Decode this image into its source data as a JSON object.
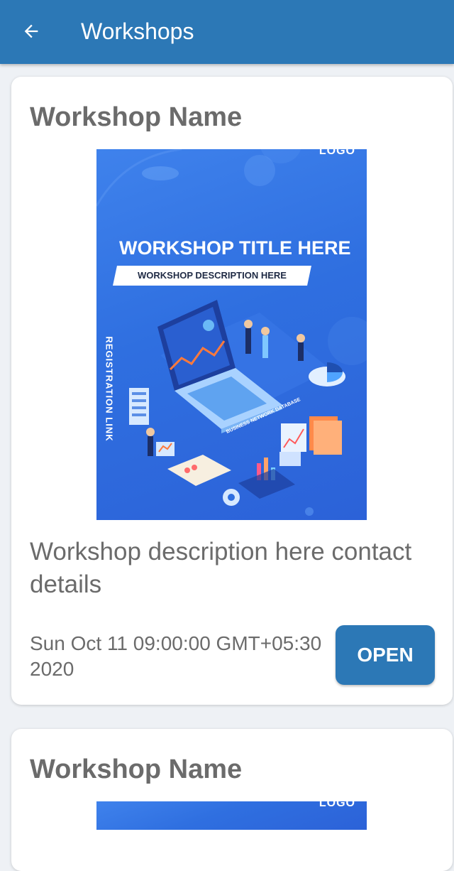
{
  "appbar": {
    "title": "Workshops",
    "back_icon": "arrow-left-icon",
    "color": "#2c78b6"
  },
  "workshops": [
    {
      "name": "Workshop Name",
      "poster": {
        "logo": "LOGO",
        "title": "WORKSHOP TITLE HERE",
        "description": "WORKSHOP DESCRIPTION HERE",
        "side_text": "REGISTRATION LINK",
        "art_label": "BUSINESS NETWORK DATABASE"
      },
      "description": "Workshop description here contact details",
      "date": "Sun Oct 11 09:00:00 GMT+05:30 2020",
      "button_label": "OPEN"
    },
    {
      "name": "Workshop Name",
      "poster": {
        "logo": "LOGO"
      }
    }
  ]
}
